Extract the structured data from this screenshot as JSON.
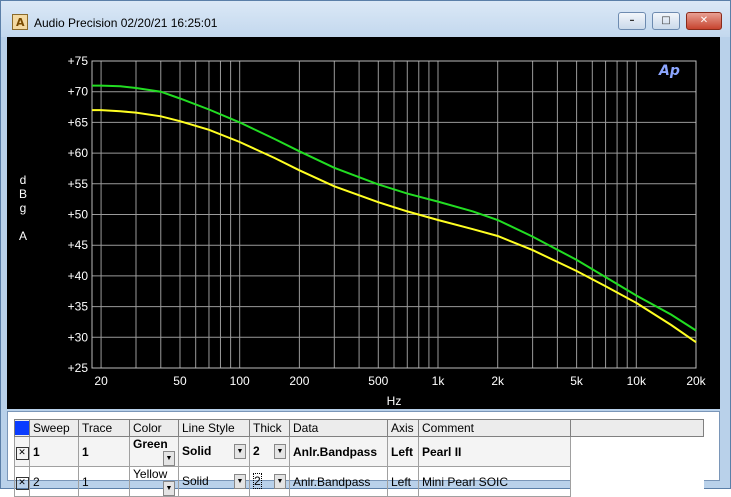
{
  "window": {
    "title": "Audio Precision  02/20/21 16:25:01",
    "buttons": {
      "minimize": "–",
      "maximize": "□",
      "close": "✕"
    }
  },
  "logo": {
    "text": "Ap"
  },
  "chart_data": {
    "type": "line",
    "xlabel": "Hz",
    "ylabel_lines": [
      "d",
      "B",
      "g",
      "",
      "A"
    ],
    "xscale": "log",
    "xlim": [
      18,
      20000
    ],
    "ylim": [
      25,
      75
    ],
    "yticks": [
      75,
      70,
      65,
      60,
      55,
      50,
      45,
      40,
      35,
      30,
      25
    ],
    "ytick_labels": [
      "+75",
      "+70",
      "+65",
      "+60",
      "+55",
      "+50",
      "+45",
      "+40",
      "+35",
      "+30",
      "+25"
    ],
    "xticks": [
      20,
      50,
      100,
      200,
      500,
      1000,
      2000,
      5000,
      10000,
      20000
    ],
    "xtick_labels": [
      "20",
      "50",
      "100",
      "200",
      "500",
      "1k",
      "2k",
      "5k",
      "10k",
      "20k"
    ],
    "grid": true,
    "series": [
      {
        "name": "Pearl II",
        "color": "#22dd22",
        "x": [
          18,
          20,
          25,
          30,
          40,
          50,
          70,
          100,
          150,
          200,
          300,
          500,
          700,
          1000,
          1500,
          2000,
          3000,
          5000,
          7000,
          10000,
          15000,
          20000
        ],
        "y": [
          71.0,
          71.0,
          70.9,
          70.6,
          70.0,
          68.9,
          67.1,
          65.0,
          62.3,
          60.3,
          57.6,
          54.9,
          53.4,
          52.1,
          50.5,
          49.1,
          46.4,
          42.6,
          39.8,
          36.8,
          33.7,
          31.1
        ]
      },
      {
        "name": "Mini Pearl SOIC",
        "color": "#ffff22",
        "x": [
          18,
          20,
          25,
          30,
          40,
          50,
          70,
          100,
          150,
          200,
          300,
          500,
          700,
          1000,
          1500,
          2000,
          3000,
          5000,
          7000,
          10000,
          15000,
          20000
        ],
        "y": [
          67.0,
          67.0,
          66.8,
          66.6,
          66.0,
          65.2,
          63.8,
          61.8,
          59.2,
          57.2,
          54.6,
          52.0,
          50.5,
          49.1,
          47.6,
          46.5,
          44.2,
          40.8,
          38.3,
          35.6,
          32.0,
          29.2
        ]
      }
    ]
  },
  "table": {
    "headers": [
      "Sweep",
      "Trace",
      "Color",
      "Line Style",
      "Thick",
      "Data",
      "Axis",
      "Comment"
    ],
    "rows": [
      {
        "sweep": "1",
        "trace": "1",
        "color": "Green",
        "style": "Solid",
        "thick": "2",
        "data": "Anlr.Bandpass",
        "axis": "Left",
        "comment": "Pearl II"
      },
      {
        "sweep": "2",
        "trace": "1",
        "color": "Yellow",
        "style": "Solid",
        "thick": "2",
        "data": "Anlr.Bandpass",
        "axis": "Left",
        "comment": "Mini Pearl SOIC"
      }
    ],
    "checkbox_mark": "✕",
    "dropdown_glyph": "▼"
  }
}
